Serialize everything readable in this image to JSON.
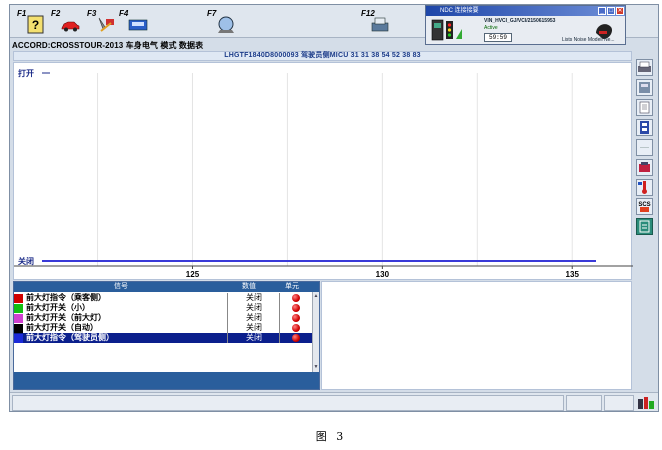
{
  "toolbar": {
    "f1_label": "F1",
    "f2_label": "F2",
    "f3_label": "F3",
    "f4_label": "F4",
    "f7_label": "F7",
    "f12_label": "F12",
    "f1_icon": "help-icon",
    "f2_icon": "car-icon",
    "f3_icon": "tools-icon",
    "f4_icon": "tech-tools-icon",
    "f7_icon": "scope-icon",
    "f12_icon": "print-icon"
  },
  "popup": {
    "title": "NDC 连接接要",
    "line1": "VIN_HVCI_GJ/VCI/2150615953",
    "line2": "Active",
    "timer": "59:59",
    "line3": "Lists Noise Modell Ne..."
  },
  "breadcrumb": "ACCORD:CROSSTOUR-2013  车身电气  模式  数据表",
  "graph_header": "LHGTF1840D8000093  驾驶员侧MICU  31 31 38 54 52 38 83",
  "chart_data": {
    "type": "line",
    "y_labels": [
      "打开",
      "关闭"
    ],
    "x_ticks": [
      125,
      130,
      135
    ],
    "xlim": [
      120.3,
      136.1
    ],
    "series_value": "关闭",
    "series_color": "#3a3ad8"
  },
  "table": {
    "headers": [
      "信号",
      "数值",
      "单元"
    ],
    "rows": [
      {
        "name": "前大灯指令（乘客侧）",
        "value": "关闭",
        "color": "#d00000",
        "selected": false
      },
      {
        "name": "前大灯开关（小）",
        "value": "关闭",
        "color": "#10c010",
        "selected": false
      },
      {
        "name": "前大灯开关（前大灯）",
        "value": "关闭",
        "color": "#d040d0",
        "selected": false
      },
      {
        "name": "前大灯开关（自动）",
        "value": "关闭",
        "color": "#000000",
        "selected": false
      },
      {
        "name": "前大灯指令（驾驶员侧）",
        "value": "关闭",
        "color": "#1a2ad8",
        "selected": true
      }
    ]
  },
  "caption": "图 3",
  "colors": {
    "table_header": "#2a5e9c",
    "selected_row": "#0b1f8c",
    "plot_line": "#3a3ad8"
  }
}
